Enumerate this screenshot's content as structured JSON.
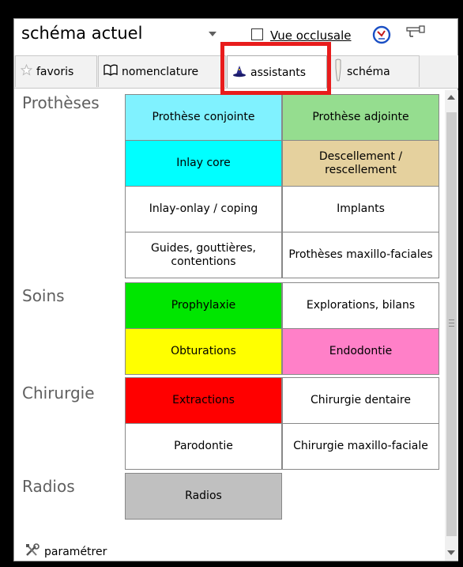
{
  "toolbar": {
    "combo_value": "schéma actuel",
    "occlusal_label": "Vue occlusale",
    "occlusal_checked": false
  },
  "tabs": [
    {
      "label": "favoris",
      "icon": "star-icon"
    },
    {
      "label": "nomenclature",
      "icon": "book-icon"
    },
    {
      "label": "assistants",
      "icon": "wizard-hat-icon",
      "active": true
    },
    {
      "label": "schéma",
      "icon": "tooth-icon"
    }
  ],
  "sections": [
    {
      "title": "Prothèses",
      "buttons": [
        {
          "label": "Prothèse conjointe",
          "color": "#80f2ff"
        },
        {
          "label": "Prothèse adjointe",
          "color": "#95dd8f"
        },
        {
          "label": "Inlay core",
          "color": "#00ffff"
        },
        {
          "label": "Descellement / rescellement",
          "color": "#e5d19e"
        },
        {
          "label": "Inlay-onlay / coping",
          "color": "#ffffff"
        },
        {
          "label": "Implants",
          "color": "#ffffff"
        },
        {
          "label": "Guides, gouttières, contentions",
          "color": "#ffffff"
        },
        {
          "label": "Prothèses maxillo-faciales",
          "color": "#ffffff"
        }
      ]
    },
    {
      "title": "Soins",
      "buttons": [
        {
          "label": "Prophylaxie",
          "color": "#00e600"
        },
        {
          "label": "Explorations, bilans",
          "color": "#ffffff"
        },
        {
          "label": "Obturations",
          "color": "#ffff00"
        },
        {
          "label": "Endodontie",
          "color": "#ff80c8"
        }
      ]
    },
    {
      "title": "Chirurgie",
      "buttons": [
        {
          "label": "Extractions",
          "color": "#ff0000"
        },
        {
          "label": "Chirurgie dentaire",
          "color": "#ffffff"
        },
        {
          "label": "Parodontie",
          "color": "#ffffff"
        },
        {
          "label": "Chirurgie maxillo-faciale",
          "color": "#ffffff"
        }
      ]
    },
    {
      "title": "Radios",
      "buttons": [
        {
          "label": "Radios",
          "color": "#c0c0c0"
        }
      ]
    }
  ],
  "footer": {
    "label": "paramétrer",
    "icon": "settings-tools-icon"
  }
}
